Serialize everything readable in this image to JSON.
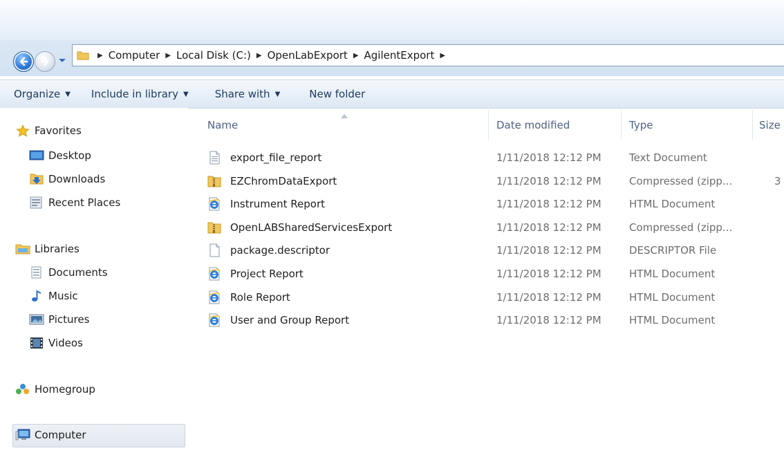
{
  "address_bar": {
    "crumbs": [
      "Computer",
      "Local Disk (C:)",
      "OpenLabExport",
      "AgilentExport"
    ]
  },
  "toolbar": {
    "organize": "Organize",
    "include_in_library": "Include in library",
    "share_with": "Share with",
    "new_folder": "New folder"
  },
  "nav": {
    "favorites": "Favorites",
    "desktop": "Desktop",
    "downloads": "Downloads",
    "recent_places": "Recent Places",
    "libraries": "Libraries",
    "documents": "Documents",
    "music": "Music",
    "pictures": "Pictures",
    "videos": "Videos",
    "homegroup": "Homegroup",
    "computer": "Computer"
  },
  "columns": {
    "name": "Name",
    "date_modified": "Date modified",
    "type": "Type",
    "size": "Size"
  },
  "files": [
    {
      "name": "export_file_report",
      "date": "1/11/2018 12:12 PM",
      "type": "Text Document",
      "size": "",
      "icon": "text-file-icon"
    },
    {
      "name": "EZChromDataExport",
      "date": "1/11/2018 12:12 PM",
      "type": "Compressed (zipp...",
      "size": "3",
      "icon": "zip-folder-icon"
    },
    {
      "name": "Instrument  Report",
      "date": "1/11/2018 12:12 PM",
      "type": "HTML Document",
      "size": "",
      "icon": "html-file-icon"
    },
    {
      "name": "OpenLABSharedServicesExport",
      "date": "1/11/2018 12:12 PM",
      "type": "Compressed (zipp...",
      "size": "",
      "icon": "zip-folder-icon"
    },
    {
      "name": "package.descriptor",
      "date": "1/11/2018 12:12 PM",
      "type": "DESCRIPTOR File",
      "size": "",
      "icon": "blank-file-icon"
    },
    {
      "name": "Project Report",
      "date": "1/11/2018 12:12 PM",
      "type": "HTML Document",
      "size": "",
      "icon": "html-file-icon"
    },
    {
      "name": "Role Report",
      "date": "1/11/2018 12:12 PM",
      "type": "HTML Document",
      "size": "",
      "icon": "html-file-icon"
    },
    {
      "name": "User and Group Report",
      "date": "1/11/2018 12:12 PM",
      "type": "HTML Document",
      "size": "",
      "icon": "html-file-icon"
    }
  ],
  "colors": {
    "toolbar_text": "#1e395b",
    "column_header": "#4d6185",
    "detail_text": "#6d6d6d",
    "window_chrome": "#dbe7f4"
  }
}
